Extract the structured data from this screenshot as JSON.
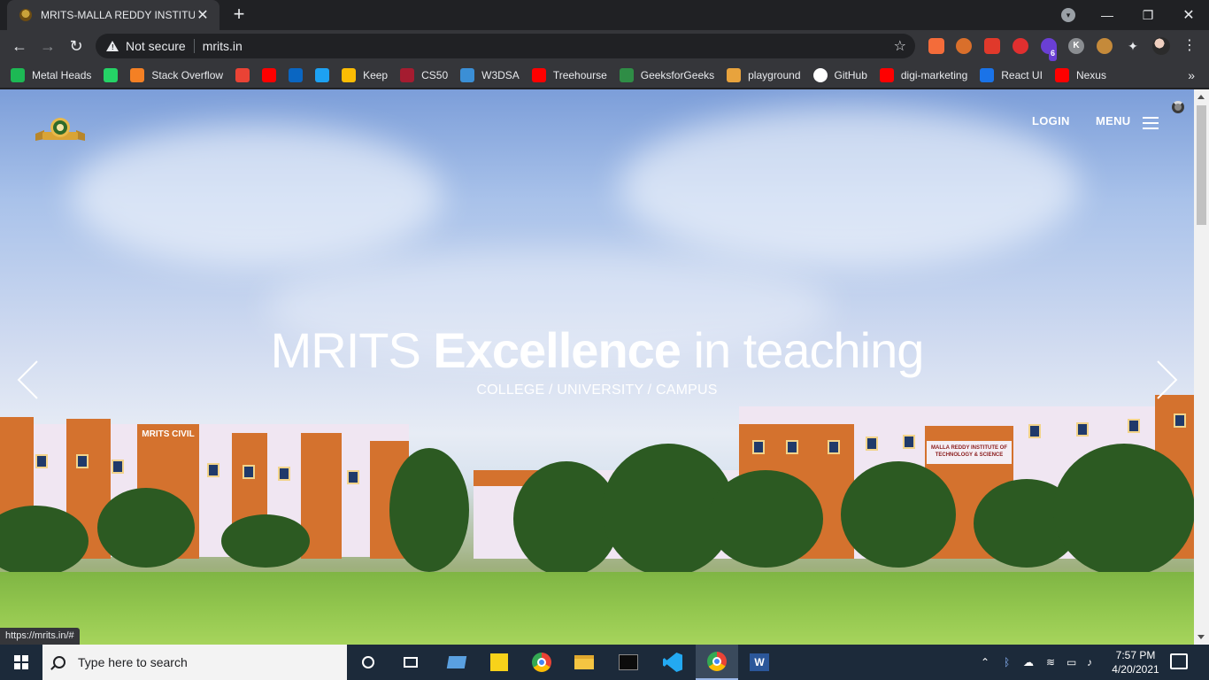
{
  "browser": {
    "tab_title": "MRITS-MALLA REDDY INSTITUTE",
    "tab_close": "✕",
    "new_tab": "+",
    "omnibox": {
      "security_label": "Not secure",
      "url": "mrits.in"
    },
    "extensions_badge": "6",
    "profile_initial": "K",
    "bookmarks": [
      {
        "label": "Metal Heads",
        "icon": "spotify-icon",
        "color": "#1db954"
      },
      {
        "label": "",
        "icon": "whatsapp-icon",
        "color": "#25d366"
      },
      {
        "label": "Stack Overflow",
        "icon": "stackoverflow-icon",
        "color": "#f48024"
      },
      {
        "label": "",
        "icon": "gmail-icon",
        "color": "#ea4335"
      },
      {
        "label": "",
        "icon": "youtube-icon",
        "color": "#ff0000"
      },
      {
        "label": "",
        "icon": "linkedin-icon",
        "color": "#0a66c2"
      },
      {
        "label": "",
        "icon": "twitter-icon",
        "color": "#1da1f2"
      },
      {
        "label": "Keep",
        "icon": "keep-icon",
        "color": "#fbbc04"
      },
      {
        "label": "CS50",
        "icon": "harvard-icon",
        "color": "#a51c30"
      },
      {
        "label": "W3DSA",
        "icon": "w3dsa-icon",
        "color": "#3b8fd6"
      },
      {
        "label": "Treehourse",
        "icon": "youtube-icon",
        "color": "#ff0000"
      },
      {
        "label": "GeeksforGeeks",
        "icon": "geeksforgeeks-icon",
        "color": "#2f8d46"
      },
      {
        "label": "playground",
        "icon": "playground-icon",
        "color": "#e8a33d"
      },
      {
        "label": "GitHub",
        "icon": "github-icon",
        "color": "#ffffff"
      },
      {
        "label": "digi-marketing",
        "icon": "youtube-icon",
        "color": "#ff0000"
      },
      {
        "label": "React UI",
        "icon": "react-ui-icon",
        "color": "#1a73e8"
      },
      {
        "label": "Nexus",
        "icon": "youtube-icon",
        "color": "#ff0000"
      }
    ],
    "status_url": "https://mrits.in/#"
  },
  "page": {
    "header": {
      "login_label": "LOGIN",
      "menu_label": "MENU"
    },
    "hero": {
      "headline_part1": "MRITS ",
      "headline_bold": "Excellence",
      "headline_part2": " in teaching",
      "subline": "COLLEGE / UNIVERSITY / CAMPUS",
      "building_sign_left": "MRITS CIVIL",
      "building_sign_right": "MALLA REDDY INSTITUTE OF TECHNOLOGY & SCIENCE"
    }
  },
  "taskbar": {
    "search_placeholder": "Type here to search",
    "time": "7:57 PM",
    "date": "4/20/2021"
  }
}
